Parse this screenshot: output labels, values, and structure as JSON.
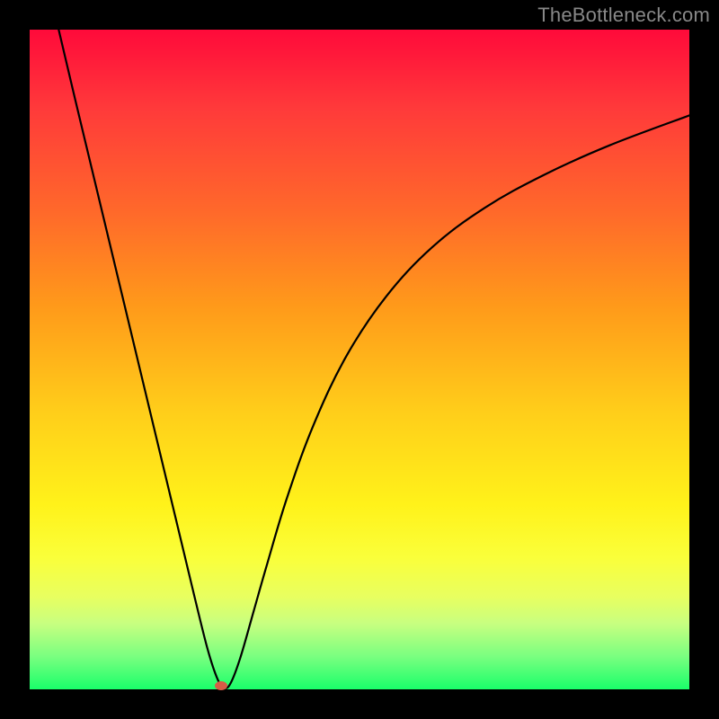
{
  "watermark": "TheBottleneck.com",
  "chart_data": {
    "type": "line",
    "title": "",
    "xlabel": "",
    "ylabel": "",
    "xlim": [
      0,
      100
    ],
    "ylim": [
      0,
      100
    ],
    "grid": false,
    "series": [
      {
        "name": "curve",
        "x": [
          4.4,
          7,
          10,
          13,
          16,
          19,
          22,
          25,
          27,
          28.5,
          29.5,
          30.5,
          32,
          34,
          36,
          39,
          43,
          48,
          54,
          61,
          69,
          78,
          88,
          100
        ],
        "y": [
          100,
          89,
          76.5,
          64,
          51.5,
          39,
          26.5,
          14,
          6,
          1.5,
          0.2,
          1,
          5,
          12,
          19,
          29,
          40,
          50.5,
          59.5,
          67,
          73,
          78,
          82.5,
          87
        ]
      }
    ],
    "marker": {
      "x": 29.0,
      "y": 0.5,
      "color": "#d75b46"
    },
    "background_gradient": [
      "#ff0a3a",
      "#ff6a2a",
      "#ffce1a",
      "#faff3a",
      "#1aff6a"
    ]
  }
}
